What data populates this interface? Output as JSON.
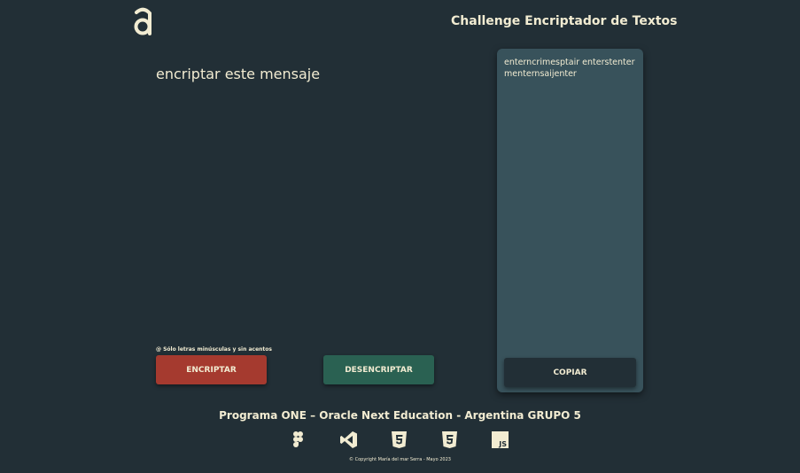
{
  "header": {
    "logo_icon": "alura-a-logo",
    "title": "Challenge Encriptador de Textos"
  },
  "main": {
    "input_value": "encriptar este mensaje",
    "hint": "@ Sólo letras minúsculas y sin acentos",
    "encrypt_label": "ENCRIPTAR",
    "decrypt_label": "DESENCRIPTAR"
  },
  "output": {
    "text": "enterncrimesptair enterstenter menternsaijenter",
    "copy_label": "COPIAR"
  },
  "footer": {
    "title": "Programa ONE – Oracle Next Education - Argentina GRUPO 5",
    "icons": [
      "figma-icon",
      "vscode-icon",
      "html5-icon",
      "css3-icon",
      "javascript-icon"
    ],
    "js_badge": "JS",
    "copyright": "© Copyright María del mar Serra - Mayo 2023"
  },
  "colors": {
    "background": "#222f36",
    "text": "#f2ecd2",
    "encrypt_button": "#a53a2f",
    "decrypt_button": "#2a6152",
    "output_panel": "#38525b"
  }
}
